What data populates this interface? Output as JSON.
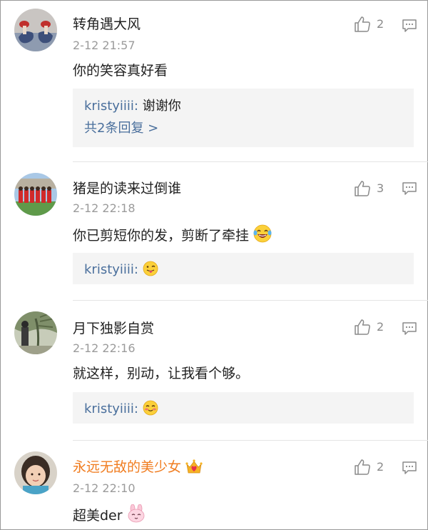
{
  "comments": [
    {
      "username": "转角遇大风",
      "time": "2-12 21:57",
      "text": "你的笑容真好看",
      "likes": "2",
      "reply": {
        "user": "kristyiiii",
        "colon": ":",
        "text": "谢谢你",
        "more": "共2条回复 >"
      },
      "icons": {
        "like": "thumbs-up-icon",
        "reply": "comment-bubble-icon"
      }
    },
    {
      "username": "猪是的读来过倒谁",
      "time": "2-12 22:18",
      "text": "你已剪短你的发，剪断了牵挂",
      "likes": "3",
      "reply": {
        "user": "kristyiiii",
        "colon": ":",
        "text": ""
      },
      "text_emoji": "laughing-tears-emoji",
      "reply_emoji": "tongue-wink-emoji"
    },
    {
      "username": "月下独影自赏",
      "time": "2-12 22:16",
      "text": "就这样，别动，让我看个够。",
      "likes": "2",
      "reply": {
        "user": "kristyiiii",
        "colon": ":",
        "text": ""
      },
      "reply_emoji": "blushing-emoji"
    },
    {
      "username": "永远无敌的美少女",
      "time": "2-12 22:10",
      "text": "超美der",
      "likes": "2",
      "username_badge": "crown-heart-badge-icon",
      "text_emoji": "pink-bunny-emoji"
    }
  ],
  "colors": {
    "link_blue": "#4a6f9c",
    "vip_orange": "#f07c1f",
    "reply_bg": "#f4f4f4",
    "meta_gray": "#9b9b9b"
  }
}
